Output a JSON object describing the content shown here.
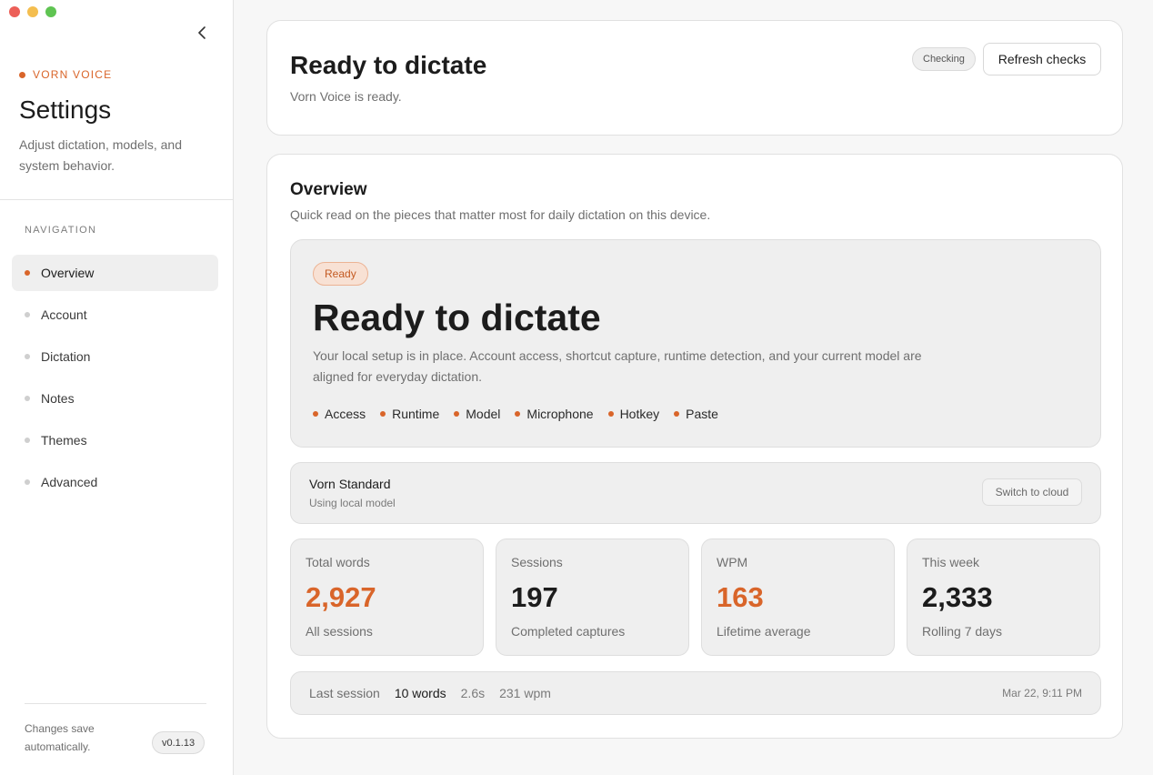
{
  "sidebar": {
    "brand": "VORN VOICE",
    "title": "Settings",
    "description": "Adjust dictation, models, and system behavior.",
    "nav_label": "NAVIGATION",
    "items": [
      {
        "label": "Overview"
      },
      {
        "label": "Account"
      },
      {
        "label": "Dictation"
      },
      {
        "label": "Notes"
      },
      {
        "label": "Themes"
      },
      {
        "label": "Advanced"
      }
    ],
    "footer_text": "Changes save automatically.",
    "version": "v0.1.13"
  },
  "status": {
    "title": "Ready to dictate",
    "subtitle": "Vorn Voice is ready.",
    "badge": "Checking",
    "refresh_label": "Refresh checks"
  },
  "overview": {
    "title": "Overview",
    "subtitle": "Quick read on the pieces that matter most for daily dictation on this device.",
    "hero": {
      "badge": "Ready",
      "title": "Ready to dictate",
      "description": "Your local setup is in place. Account access, shortcut capture, runtime detection, and your current model are aligned for everyday dictation.",
      "chips": [
        "Access",
        "Runtime",
        "Model",
        "Microphone",
        "Hotkey",
        "Paste"
      ]
    },
    "model": {
      "name": "Vorn Standard",
      "subtitle": "Using local model",
      "switch_label": "Switch to cloud"
    },
    "stats": [
      {
        "label": "Total words",
        "value": "2,927",
        "sub": "All sessions"
      },
      {
        "label": "Sessions",
        "value": "197",
        "sub": "Completed captures"
      },
      {
        "label": "WPM",
        "value": "163",
        "sub": "Lifetime average"
      },
      {
        "label": "This week",
        "value": "2,333",
        "sub": "Rolling 7 days"
      }
    ],
    "last_session": {
      "label": "Last session",
      "words": "10 words",
      "duration": "2.6s",
      "wpm": "231 wpm",
      "time": "Mar 22, 9:11 PM"
    }
  },
  "colors": {
    "accent": "#d9652a",
    "background": "#f7f7f7",
    "card": "#ffffff",
    "panel": "#efefef"
  }
}
